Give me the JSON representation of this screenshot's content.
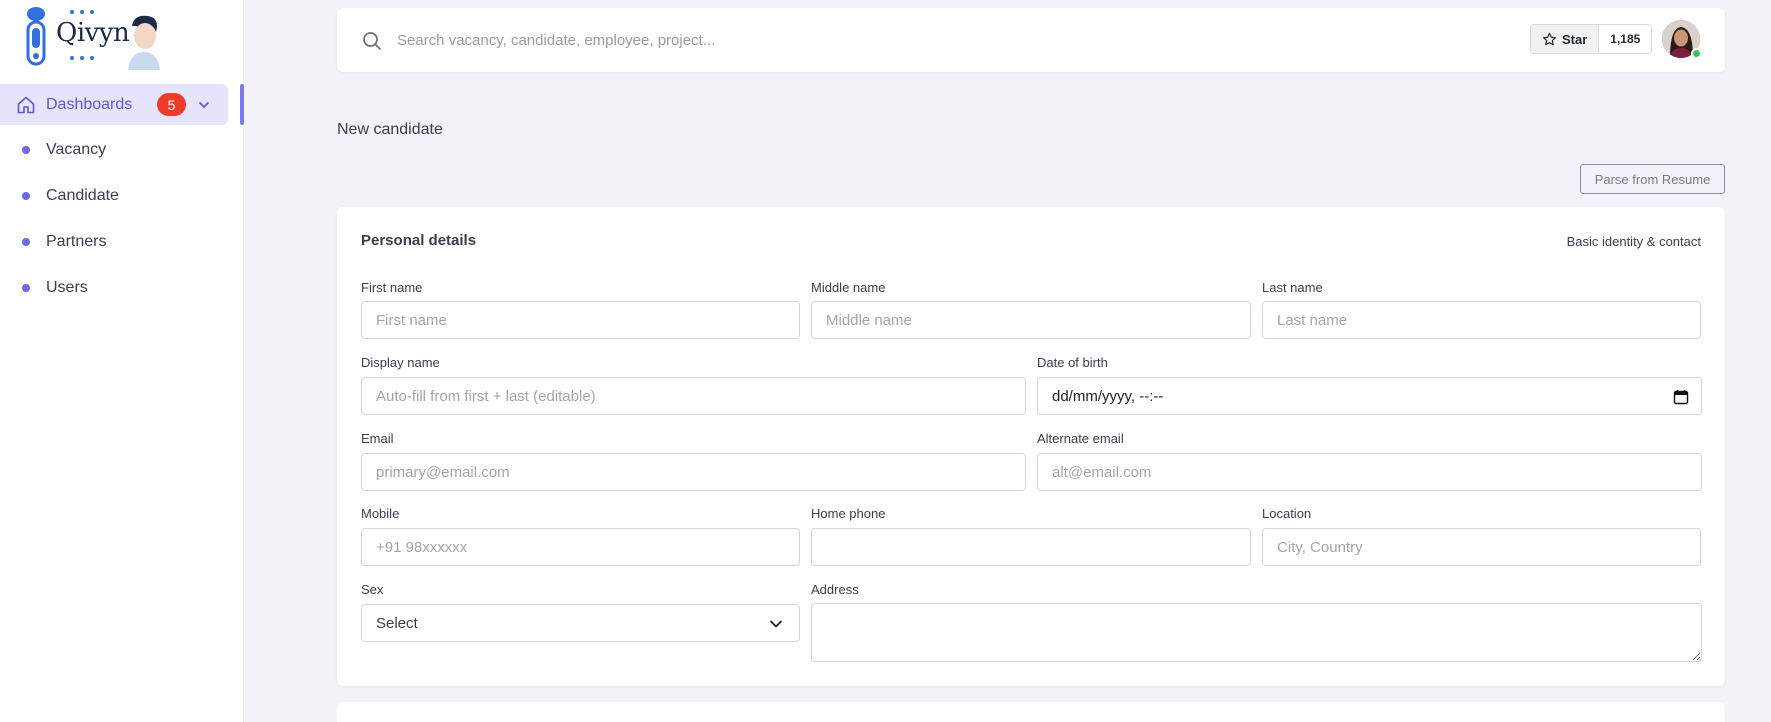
{
  "brand": {
    "name": "Qivyn"
  },
  "sidebar": {
    "active": {
      "label": "Dashboards",
      "badge": "5"
    },
    "items": [
      {
        "label": "Vacancy"
      },
      {
        "label": "Candidate"
      },
      {
        "label": "Partners"
      },
      {
        "label": "Users"
      }
    ]
  },
  "topbar": {
    "search_placeholder": "Search vacancy, candidate, employee, project...",
    "star_label": "Star",
    "star_count": "1,185"
  },
  "page": {
    "title": "New candidate",
    "parse_button": "Parse from Resume"
  },
  "personal": {
    "title": "Personal details",
    "subtitle": "Basic identity & contact",
    "first_name": {
      "label": "First name",
      "placeholder": "First name"
    },
    "middle_name": {
      "label": "Middle name",
      "placeholder": "Middle name"
    },
    "last_name": {
      "label": "Last name",
      "placeholder": "Last name"
    },
    "display_name": {
      "label": "Display name",
      "placeholder": "Auto-fill from first + last (editable)"
    },
    "dob": {
      "label": "Date of birth",
      "value": "dd/mm/yyyy, --:--"
    },
    "email": {
      "label": "Email",
      "placeholder": "primary@email.com"
    },
    "alt_email": {
      "label": "Alternate email",
      "placeholder": "alt@email.com"
    },
    "mobile": {
      "label": "Mobile",
      "placeholder": "+91 98xxxxxx"
    },
    "home_phone": {
      "label": "Home phone",
      "placeholder": ""
    },
    "location": {
      "label": "Location",
      "placeholder": "City, Country"
    },
    "sex": {
      "label": "Sex",
      "value": "Select"
    },
    "address": {
      "label": "Address"
    }
  },
  "colors": {
    "accent": "#6c68e8",
    "badge": "#ef3b2a",
    "background": "#f3f2f8"
  }
}
